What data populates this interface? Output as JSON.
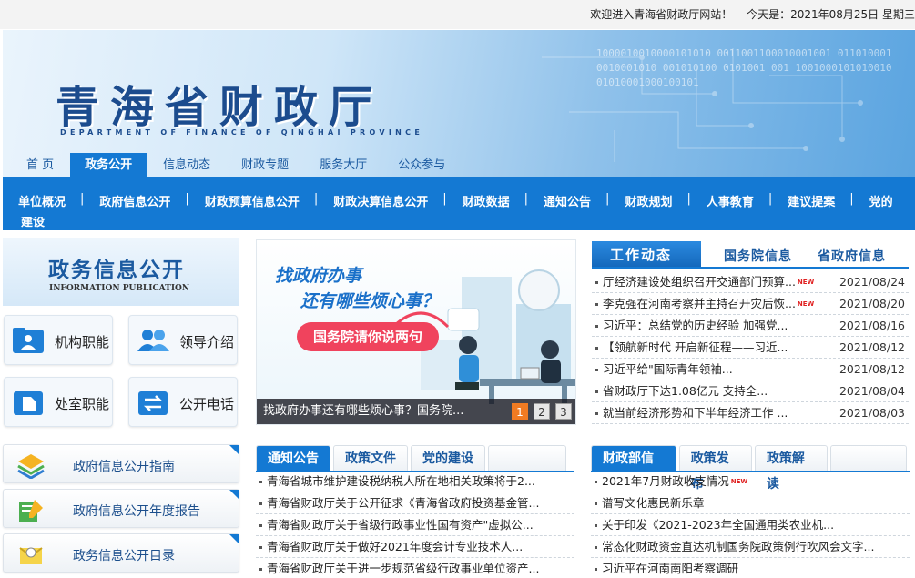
{
  "topbar": {
    "welcome": "欢迎进入青海省财政厅网站！",
    "date": "今天是：2021年08月25日 星期三"
  },
  "banner": {
    "title": "青海省财政厅",
    "subtitle": "DEPARTMENT OF FINANCE OF QINGHAI PROVINCE",
    "deco_binary": "1000010010000101010 0011001100010001001 0110100010010001010 001010100 0101001 001 1001000101010010 01010001000100101"
  },
  "mainnav": [
    "首 页",
    "政务公开",
    "信息动态",
    "财政专题",
    "服务大厅",
    "公众参与"
  ],
  "subnav": {
    "items": [
      "单位概况",
      "政府信息公开",
      "财政预算信息公开",
      "财政决算信息公开",
      "财政数据",
      "通知公告",
      "财政规划",
      "人事教育",
      "建议提案",
      "党的"
    ],
    "wrap": "建设"
  },
  "left": {
    "header_title": "政务信息公开",
    "header_sub": "INFORMATION PUBLICATION",
    "tiles": [
      "机构职能",
      "领导介绍",
      "处室职能",
      "公开电话"
    ],
    "buttons": [
      "政府信息公开指南",
      "政府信息公开年度报告",
      "政务信息公开目录"
    ]
  },
  "slide": {
    "headline1": "找政府办事",
    "headline2": "还有哪些烦心事？",
    "pill": "国务院请你说两句",
    "caption": "找政府办事还有哪些烦心事？国务院...",
    "pages": [
      "1",
      "2",
      "3"
    ]
  },
  "work": {
    "tabs": [
      "工作动态",
      "国务院信息",
      "省政府信息"
    ],
    "new_tag": "NEW",
    "items": [
      {
        "title": "厅经济建设处组织召开交通部门预算...",
        "date": "2021/08/24",
        "new": true
      },
      {
        "title": "李克强在河南考察并主持召开灾后恢...",
        "date": "2021/08/20",
        "new": true
      },
      {
        "title": "习近平：总结党的历史经验 加强党...",
        "date": "2021/08/16",
        "new": false
      },
      {
        "title": "【领航新时代 开启新征程——习近...",
        "date": "2021/08/12",
        "new": false
      },
      {
        "title": "习近平给\"国际青年领袖...",
        "date": "2021/08/12",
        "new": false
      },
      {
        "title": "省财政厅下达1.08亿元 支持全...",
        "date": "2021/08/04",
        "new": false
      },
      {
        "title": "就当前经济形势和下半年经济工作 ...",
        "date": "2021/08/03",
        "new": false
      }
    ]
  },
  "notice": {
    "tabs": [
      "通知公告",
      "政策文件",
      "党的建设"
    ],
    "items": [
      "青海省城市维护建设税纳税人所在地相关政策将于2...",
      "青海省财政厅关于公开征求《青海省政府投资基金管...",
      "青海省财政厅关于省级行政事业性国有资产\"虚拟公...",
      "青海省财政厅关于做好2021年度会计专业技术人...",
      "青海省财政厅关于进一步规范省级行政事业单位资产..."
    ]
  },
  "ministry": {
    "tabs": [
      "财政部信息",
      "政策发布",
      "政策解读"
    ],
    "items": [
      {
        "title": "2021年7月财政收支情况",
        "new": true
      },
      {
        "title": "谱写文化惠民新乐章",
        "new": false
      },
      {
        "title": "关于印发《2021-2023年全国通用类农业机...",
        "new": false
      },
      {
        "title": "常态化财政资金直达机制国务院政策例行吹风会文字...",
        "new": false
      },
      {
        "title": "习近平在河南南阳考察调研",
        "new": false
      }
    ]
  }
}
